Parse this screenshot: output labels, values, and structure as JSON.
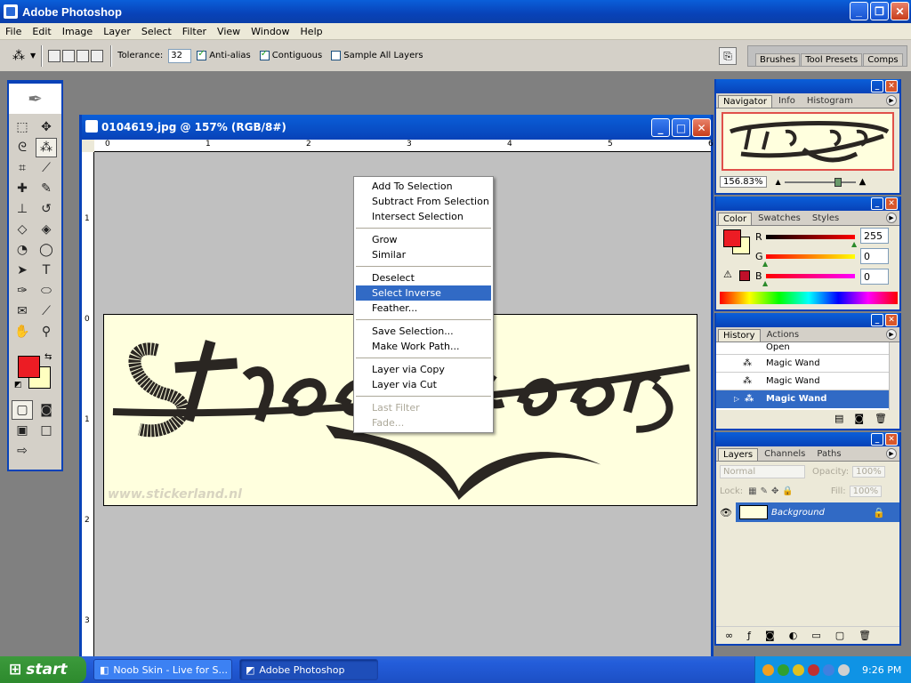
{
  "app": {
    "title": "Adobe Photoshop",
    "window_buttons": [
      "_",
      "❐",
      "✕"
    ]
  },
  "menu": [
    "File",
    "Edit",
    "Image",
    "Layer",
    "Select",
    "Filter",
    "View",
    "Window",
    "Help"
  ],
  "options": {
    "tolerance_label": "Tolerance:",
    "tolerance_value": "32",
    "antialias": "Anti-alias",
    "contiguous": "Contiguous",
    "sample_all": "Sample All Layers"
  },
  "palette_well": [
    "Brushes",
    "Tool Presets",
    "Comps"
  ],
  "document": {
    "title": "0104619.jpg @ 157% (RGB/8#)",
    "ruler_top": [
      "0",
      "1",
      "2",
      "3",
      "4",
      "5",
      "6"
    ],
    "ruler_left": [
      "1",
      "0",
      "1",
      "2",
      "3"
    ],
    "watermark": "www.stickerland.nl"
  },
  "context_menu": {
    "groups": [
      [
        "Add To Selection",
        "Subtract From Selection",
        "Intersect Selection"
      ],
      [
        "Grow",
        "Similar"
      ],
      [
        "Deselect",
        "Select Inverse",
        "Feather..."
      ],
      [
        "Save Selection...",
        "Make Work Path..."
      ],
      [
        "Layer via Copy",
        "Layer via Cut"
      ],
      [
        "Last Filter",
        "Fade..."
      ]
    ],
    "highlighted": "Select Inverse",
    "disabled": [
      "Last Filter",
      "Fade..."
    ]
  },
  "navigator": {
    "tabs": [
      "Navigator",
      "Info",
      "Histogram"
    ],
    "zoom": "156.83%"
  },
  "color": {
    "tabs": [
      "Color",
      "Swatches",
      "Styles"
    ],
    "r_label": "R",
    "g_label": "G",
    "b_label": "B",
    "r": "255",
    "g": "0",
    "b": "0",
    "fg_color": "#ec1c24",
    "bg_color": "#ffffc0"
  },
  "history": {
    "tabs": [
      "History",
      "Actions"
    ],
    "items": [
      "Open",
      "Magic Wand",
      "Magic Wand",
      "Magic Wand"
    ],
    "selected_index": 3
  },
  "layers": {
    "tabs": [
      "Layers",
      "Channels",
      "Paths"
    ],
    "blend_mode": "Normal",
    "opacity_label": "Opacity:",
    "opacity": "100%",
    "lock_label": "Lock:",
    "fill_label": "Fill:",
    "fill": "100%",
    "layer_name": "Background"
  },
  "taskbar": {
    "start": "start",
    "tasks": [
      "Noob Skin - Live for S...",
      "Adobe Photoshop"
    ],
    "clock": "9:26 PM"
  }
}
